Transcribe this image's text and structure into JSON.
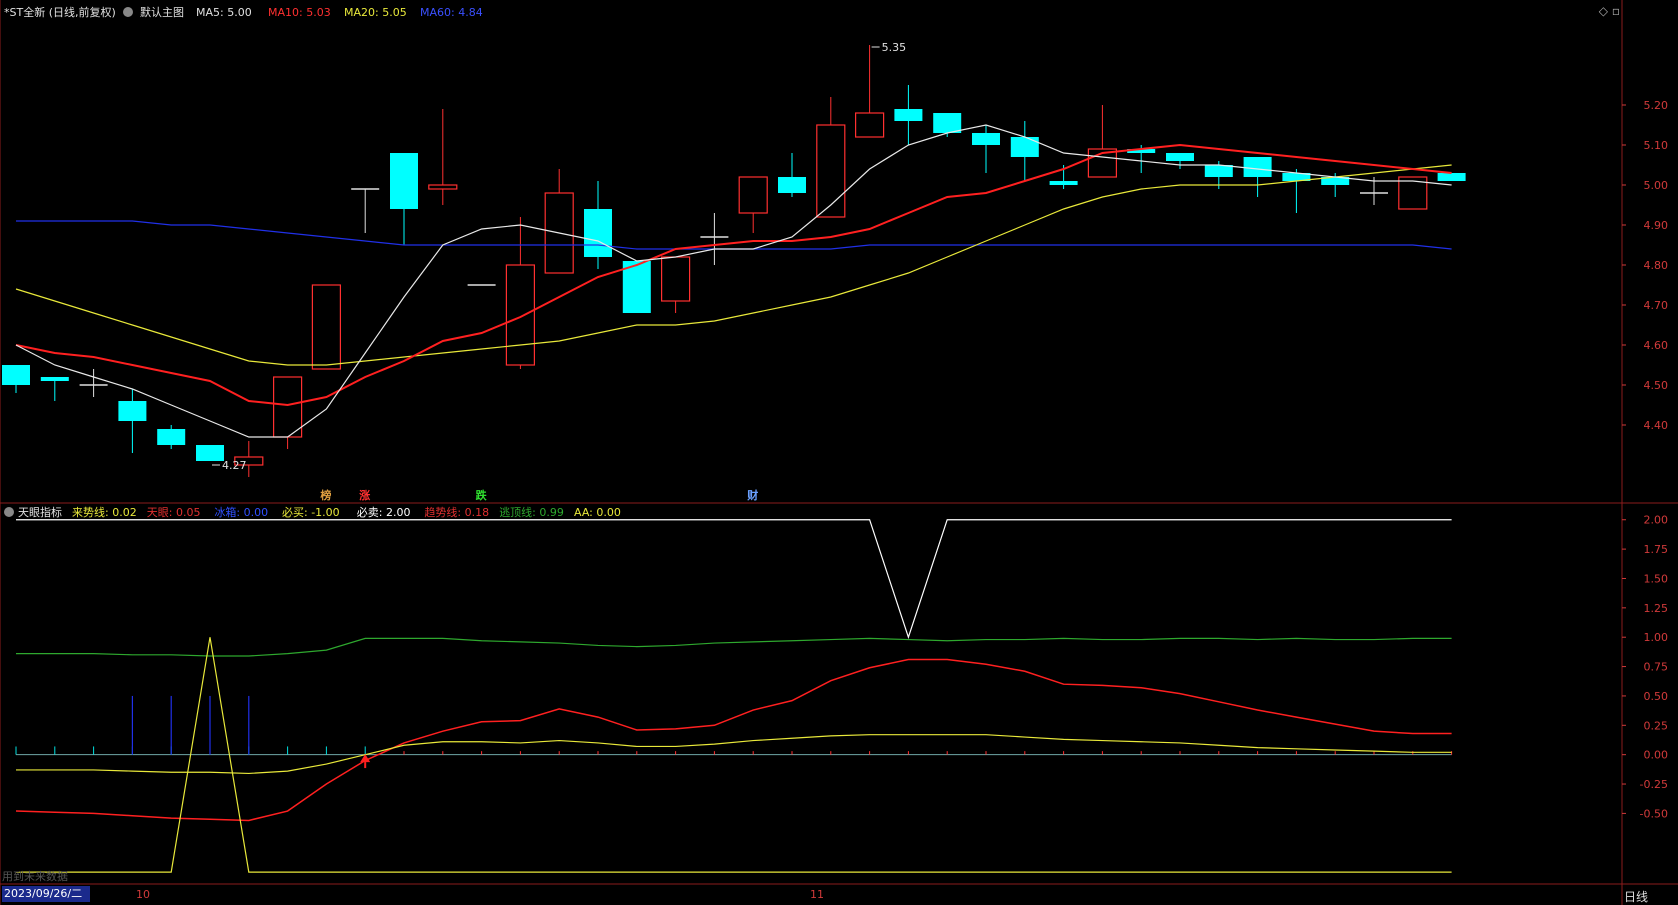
{
  "top_legend": {
    "symbol": "*ST全新 (日线,前复权)",
    "main_label": "默认主图",
    "ma5": "MA5: 5.00",
    "ma10": "MA10: 5.03",
    "ma20": "MA20: 5.05",
    "ma60": "MA60: 4.84"
  },
  "bottom_legend": {
    "name": "天眼指标",
    "items": [
      {
        "text": "来势线: 0.02",
        "color": "#e8e83a"
      },
      {
        "text": "天眼: 0.05",
        "color": "#e03030"
      },
      {
        "text": "冰箱: 0.00",
        "color": "#3050ff"
      },
      {
        "text": "必买: -1.00",
        "color": "#e8e83a"
      },
      {
        "text": "必卖: 2.00",
        "color": "#ffffff"
      },
      {
        "text": "趋势线: 0.18",
        "color": "#e03030"
      },
      {
        "text": "逃顶线: 0.99",
        "color": "#2ea82e"
      },
      {
        "text": "AA: 0.00",
        "color": "#e8e83a"
      }
    ]
  },
  "markers": [
    {
      "text": "榜",
      "color": "#e0a040",
      "candle": 8
    },
    {
      "text": "涨",
      "color": "#ff3030",
      "candle": 9
    },
    {
      "text": "跌",
      "color": "#30e030",
      "candle": 12
    },
    {
      "text": "财",
      "color": "#6aa0ff",
      "candle": 19
    }
  ],
  "footer": {
    "date": "2023/09/26/二",
    "month_10": "10",
    "month_11": "11",
    "period": "日线",
    "watermark": "用到未来数据"
  },
  "colors": {
    "up": "#ff3030",
    "down": "#00ffff",
    "ma5": "#e8e8e8",
    "ma10": "#ff2020",
    "ma20": "#e8e83a",
    "ma60": "#2030e8",
    "axis": "#d13a3a"
  },
  "chart_data": [
    {
      "type": "candlestick",
      "title": "默认主图",
      "ylim": [
        4.25,
        5.4
      ],
      "yticks": [
        4.4,
        4.5,
        4.6,
        4.7,
        4.8,
        4.9,
        5.0,
        5.1,
        5.2
      ],
      "annotations": [
        {
          "text": "5.35",
          "candle": 22
        },
        {
          "text": "4.27",
          "candle": 5
        }
      ],
      "candles": [
        {
          "o": 4.55,
          "h": 4.55,
          "l": 4.48,
          "c": 4.5
        },
        {
          "o": 4.52,
          "h": 4.52,
          "l": 4.46,
          "c": 4.51
        },
        {
          "o": 4.5,
          "h": 4.54,
          "l": 4.47,
          "c": 4.5
        },
        {
          "o": 4.46,
          "h": 4.49,
          "l": 4.33,
          "c": 4.41
        },
        {
          "o": 4.39,
          "h": 4.4,
          "l": 4.34,
          "c": 4.35
        },
        {
          "o": 4.35,
          "h": 4.35,
          "l": 4.31,
          "c": 4.31
        },
        {
          "o": 4.3,
          "h": 4.36,
          "l": 4.27,
          "c": 4.32
        },
        {
          "o": 4.37,
          "h": 4.52,
          "l": 4.34,
          "c": 4.52
        },
        {
          "o": 4.54,
          "h": 4.75,
          "l": 4.54,
          "c": 4.75
        },
        {
          "o": 4.99,
          "h": 4.99,
          "l": 4.88,
          "c": 4.99
        },
        {
          "o": 5.08,
          "h": 5.08,
          "l": 4.85,
          "c": 4.94
        },
        {
          "o": 4.99,
          "h": 5.19,
          "l": 4.95,
          "c": 5.0
        },
        {
          "o": 4.75,
          "h": 4.75,
          "l": 4.75,
          "c": 4.75
        },
        {
          "o": 4.55,
          "h": 4.92,
          "l": 4.54,
          "c": 4.8
        },
        {
          "o": 4.78,
          "h": 5.04,
          "l": 4.78,
          "c": 4.98
        },
        {
          "o": 4.94,
          "h": 5.01,
          "l": 4.79,
          "c": 4.82
        },
        {
          "o": 4.81,
          "h": 4.81,
          "l": 4.68,
          "c": 4.68
        },
        {
          "o": 4.71,
          "h": 4.82,
          "l": 4.68,
          "c": 4.82
        },
        {
          "o": 4.87,
          "h": 4.93,
          "l": 4.8,
          "c": 4.87
        },
        {
          "o": 4.93,
          "h": 5.02,
          "l": 4.88,
          "c": 5.02
        },
        {
          "o": 5.02,
          "h": 5.08,
          "l": 4.97,
          "c": 4.98
        },
        {
          "o": 4.92,
          "h": 5.22,
          "l": 4.92,
          "c": 5.15
        },
        {
          "o": 5.12,
          "h": 5.35,
          "l": 5.12,
          "c": 5.18
        },
        {
          "o": 5.19,
          "h": 5.25,
          "l": 5.1,
          "c": 5.16
        },
        {
          "o": 5.18,
          "h": 5.18,
          "l": 5.12,
          "c": 5.13
        },
        {
          "o": 5.13,
          "h": 5.15,
          "l": 5.03,
          "c": 5.1
        },
        {
          "o": 5.12,
          "h": 5.16,
          "l": 5.01,
          "c": 5.07
        },
        {
          "o": 5.01,
          "h": 5.05,
          "l": 4.99,
          "c": 5.0
        },
        {
          "o": 5.02,
          "h": 5.2,
          "l": 5.02,
          "c": 5.09
        },
        {
          "o": 5.09,
          "h": 5.1,
          "l": 5.03,
          "c": 5.08
        },
        {
          "o": 5.08,
          "h": 5.08,
          "l": 5.04,
          "c": 5.06
        },
        {
          "o": 5.05,
          "h": 5.06,
          "l": 4.99,
          "c": 5.02
        },
        {
          "o": 5.07,
          "h": 5.07,
          "l": 4.97,
          "c": 5.02
        },
        {
          "o": 5.03,
          "h": 5.04,
          "l": 4.93,
          "c": 5.01
        },
        {
          "o": 5.02,
          "h": 5.03,
          "l": 4.97,
          "c": 5.0
        },
        {
          "o": 4.98,
          "h": 5.02,
          "l": 4.95,
          "c": 4.98
        },
        {
          "o": 4.94,
          "h": 5.02,
          "l": 4.94,
          "c": 5.02
        },
        {
          "o": 5.03,
          "h": 5.03,
          "l": 5.01,
          "c": 5.01
        }
      ],
      "series": [
        {
          "name": "MA5",
          "values": [
            4.6,
            4.55,
            4.52,
            4.49,
            4.45,
            4.41,
            4.37,
            4.37,
            4.44,
            4.58,
            4.72,
            4.85,
            4.89,
            4.9,
            4.88,
            4.86,
            4.81,
            4.82,
            4.84,
            4.84,
            4.87,
            4.95,
            5.04,
            5.1,
            5.13,
            5.15,
            5.12,
            5.08,
            5.07,
            5.06,
            5.05,
            5.05,
            5.04,
            5.03,
            5.02,
            5.01,
            5.01,
            5.0
          ]
        },
        {
          "name": "MA10",
          "values": [
            4.6,
            4.58,
            4.57,
            4.55,
            4.53,
            4.51,
            4.46,
            4.45,
            4.47,
            4.52,
            4.56,
            4.61,
            4.63,
            4.67,
            4.72,
            4.77,
            4.8,
            4.84,
            4.85,
            4.86,
            4.86,
            4.87,
            4.89,
            4.93,
            4.97,
            4.98,
            5.01,
            5.04,
            5.08,
            5.09,
            5.1,
            5.09,
            5.08,
            5.07,
            5.06,
            5.05,
            5.04,
            5.03
          ]
        },
        {
          "name": "MA20",
          "values": [
            4.74,
            4.71,
            4.68,
            4.65,
            4.62,
            4.59,
            4.56,
            4.55,
            4.55,
            4.56,
            4.57,
            4.58,
            4.59,
            4.6,
            4.61,
            4.63,
            4.65,
            4.65,
            4.66,
            4.68,
            4.7,
            4.72,
            4.75,
            4.78,
            4.82,
            4.86,
            4.9,
            4.94,
            4.97,
            4.99,
            5.0,
            5.0,
            5.0,
            5.01,
            5.02,
            5.03,
            5.04,
            5.05
          ]
        },
        {
          "name": "MA60",
          "values": [
            4.91,
            4.91,
            4.91,
            4.91,
            4.9,
            4.9,
            4.89,
            4.88,
            4.87,
            4.86,
            4.85,
            4.85,
            4.85,
            4.85,
            4.85,
            4.85,
            4.84,
            4.84,
            4.84,
            4.84,
            4.84,
            4.84,
            4.85,
            4.85,
            4.85,
            4.85,
            4.85,
            4.85,
            4.85,
            4.85,
            4.85,
            4.85,
            4.85,
            4.85,
            4.85,
            4.85,
            4.85,
            4.84
          ]
        }
      ]
    },
    {
      "type": "line",
      "title": "天眼指标",
      "ylim": [
        -1.05,
        2.1
      ],
      "yticks": [
        2.0,
        1.75,
        1.5,
        1.25,
        1.0,
        0.75,
        0.5,
        0.25,
        0.0,
        -0.25,
        -0.5
      ],
      "series": [
        {
          "name": "必卖",
          "values": [
            2.0,
            2.0,
            2.0,
            2.0,
            2.0,
            2.0,
            2.0,
            2.0,
            2.0,
            2.0,
            2.0,
            2.0,
            2.0,
            2.0,
            2.0,
            2.0,
            2.0,
            2.0,
            2.0,
            2.0,
            2.0,
            2.0,
            2.0,
            1.0,
            2.0,
            2.0,
            2.0,
            2.0,
            2.0,
            2.0,
            2.0,
            2.0,
            2.0,
            2.0,
            2.0,
            2.0,
            2.0,
            2.0
          ]
        },
        {
          "name": "逃顶线",
          "values": [
            0.86,
            0.86,
            0.86,
            0.85,
            0.85,
            0.84,
            0.84,
            0.86,
            0.89,
            0.99,
            0.99,
            0.99,
            0.97,
            0.96,
            0.95,
            0.93,
            0.92,
            0.93,
            0.95,
            0.96,
            0.97,
            0.98,
            0.99,
            0.98,
            0.97,
            0.98,
            0.98,
            0.99,
            0.98,
            0.98,
            0.99,
            0.99,
            0.98,
            0.99,
            0.98,
            0.98,
            0.99,
            0.99
          ]
        },
        {
          "name": "趋势线",
          "values": [
            -0.48,
            -0.49,
            -0.5,
            -0.52,
            -0.54,
            -0.55,
            -0.56,
            -0.48,
            -0.25,
            -0.05,
            0.1,
            0.2,
            0.28,
            0.29,
            0.39,
            0.32,
            0.21,
            0.22,
            0.25,
            0.38,
            0.46,
            0.63,
            0.74,
            0.81,
            0.81,
            0.77,
            0.71,
            0.6,
            0.59,
            0.57,
            0.52,
            0.45,
            0.38,
            0.32,
            0.26,
            0.2,
            0.18,
            0.18
          ]
        },
        {
          "name": "来势线",
          "values": [
            -0.13,
            -0.13,
            -0.13,
            -0.14,
            -0.15,
            -0.15,
            -0.16,
            -0.14,
            -0.08,
            0.0,
            0.08,
            0.11,
            0.11,
            0.1,
            0.12,
            0.1,
            0.07,
            0.07,
            0.09,
            0.12,
            0.14,
            0.16,
            0.17,
            0.17,
            0.17,
            0.17,
            0.15,
            0.13,
            0.12,
            0.11,
            0.1,
            0.08,
            0.06,
            0.05,
            0.04,
            0.03,
            0.02,
            0.02
          ]
        },
        {
          "name": "必买",
          "values": [
            -1.0,
            -1.0,
            -1.0,
            -1.0,
            -1.0,
            1.0,
            -1.0,
            -1.0,
            -1.0,
            -1.0,
            -1.0,
            -1.0,
            -1.0,
            -1.0,
            -1.0,
            -1.0,
            -1.0,
            -1.0,
            -1.0,
            -1.0,
            -1.0,
            -1.0,
            -1.0,
            -1.0,
            -1.0,
            -1.0,
            -1.0,
            -1.0,
            -1.0,
            -1.0,
            -1.0,
            -1.0,
            -1.0,
            -1.0,
            -1.0,
            -1.0,
            -1.0,
            -1.0
          ]
        }
      ],
      "sticks_cyan": [
        -0.02,
        -0.02,
        -0.02,
        -0.02,
        -0.02,
        -0.02,
        -0.02,
        -0.02,
        -0.02,
        -0.02
      ],
      "sticks_blue": [
        0,
        0,
        0,
        0.5,
        0.5,
        0.5,
        0.5,
        0,
        0,
        0
      ],
      "sticks_red_from": 10,
      "arrow_candle": 9
    }
  ]
}
